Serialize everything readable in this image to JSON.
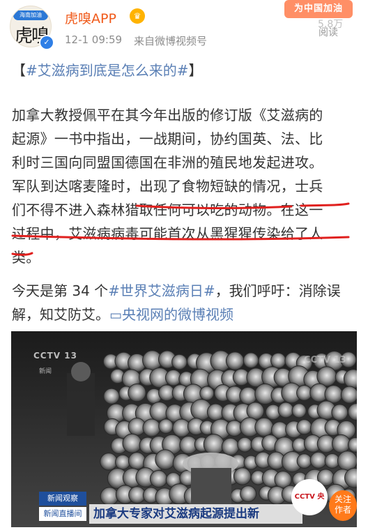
{
  "header": {
    "avatar_ribbon": "海南加油",
    "avatar_glyph": "虎嗅",
    "author_name": "虎嗅APP",
    "time": "12-1 09:59",
    "source": "来自微博视频号",
    "badge": "为中国加油",
    "read_count": "5.8万",
    "read_label": "阅读"
  },
  "post": {
    "topic_open": "【",
    "topic": "#艾滋病到底是怎么来的#",
    "topic_close": "】",
    "main_lines": [
      "加拿大教授佩平在其今年出版的修订版《艾滋病的",
      "起源》一书中指出，一战期间，协约国英、法、比",
      "利时三国向同盟国德国在非洲的殖民地发起进攻。",
      "军队到达喀麦隆时，出现了食物短缺的情况，士兵",
      "们不得不进入森林猎取任何可以吃的动物。在这一",
      "过程中，艾滋病病毒可能首次从黑猩猩传染给了人",
      "类。"
    ],
    "tail_line1_prefix": "今天是第 34 个",
    "tail_hashtag": "#世界艾滋病日#",
    "tail_line1_suffix": "，我们呼吁：消除误",
    "tail_line2_prefix": "解，知艾防艾。",
    "video_link": "央视网的微博视频"
  },
  "video": {
    "cctv_logo": "CCTV 13",
    "cctv_sub": "新闻",
    "watermark": "CCTV 13",
    "tag1": "新闻观察",
    "tag2": "新闻直播间",
    "headline": "加拿大专家对艾滋病起源提出新",
    "cctv_round": "CCTV 央视",
    "follow": "关注\n作者"
  },
  "colors": {
    "brand_orange": "#f05a1a",
    "link_blue": "#5a7fb5",
    "underline_red": "#e0201e"
  }
}
